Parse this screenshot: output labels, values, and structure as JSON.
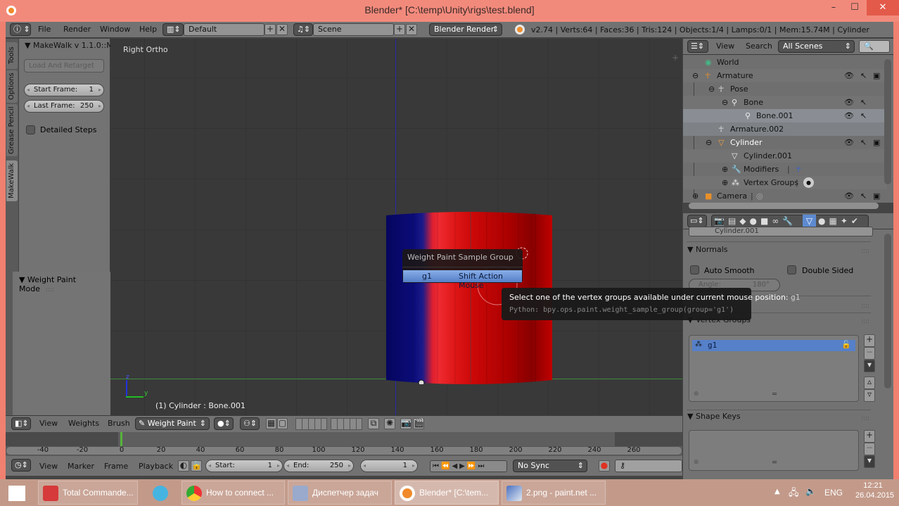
{
  "window": {
    "title": "Blender* [C:\\temp\\Unity\\rigs\\test.blend]",
    "minimize": "–",
    "maximize": "☐",
    "close": "✕"
  },
  "topbar": {
    "menus": [
      "File",
      "Render",
      "Window",
      "Help"
    ],
    "layout": "Default",
    "scene": "Scene",
    "engine": "Blender Render",
    "stats": "v2.74 | Verts:64 | Faces:36 | Tris:124 | Objects:1/4 | Lamps:0/1 | Mem:15.74M | Cylinder"
  },
  "left_tabs": [
    "Tools",
    "Options",
    "Grease Pencil",
    "MakeWalk"
  ],
  "toolshelf": {
    "panel_title": "MakeWalk v 1.1.0::M",
    "load_button": "Load And Retarget",
    "start_frame_label": "Start Frame:",
    "start_frame_value": "1",
    "last_frame_label": "Last Frame:",
    "last_frame_value": "250",
    "detailed_steps": "Detailed Steps",
    "mode_panel": "Weight Paint Mode"
  },
  "viewport": {
    "view_label": "Right Ortho",
    "object_label": "(1) Cylinder : Bone.001",
    "axis_z": "z",
    "axis_y": "y"
  },
  "popup": {
    "title": "Weight Paint Sample Group",
    "item_label": "g1",
    "item_shortcut": "Shift Action Mouse"
  },
  "tooltip": {
    "text": "Select one of the vertex groups available under current mouse position: ",
    "value": "g1",
    "python": "Python: bpy.ops.paint.weight_sample_group(group='g1')"
  },
  "outliner": {
    "view": "View",
    "search": "Search",
    "filter": "All Scenes",
    "items": [
      {
        "label": "World",
        "icon": "world-icon"
      },
      {
        "label": "Armature",
        "icon": "armature-icon"
      },
      {
        "label": "Pose",
        "icon": "pose-icon"
      },
      {
        "label": "Bone",
        "icon": "bone-icon"
      },
      {
        "label": "Bone.001",
        "icon": "bone-icon"
      },
      {
        "label": "Armature.002",
        "icon": "armature-data-icon"
      },
      {
        "label": "Cylinder",
        "icon": "mesh-object-icon"
      },
      {
        "label": "Cylinder.001",
        "icon": "mesh-data-icon"
      },
      {
        "label": "Modifiers",
        "icon": "wrench-icon"
      },
      {
        "label": "Vertex Groups",
        "icon": "vertex-groups-icon"
      },
      {
        "label": "Camera",
        "icon": "camera-icon"
      }
    ]
  },
  "properties": {
    "mesh_name": "Cylinder.001",
    "normals_title": "Normals",
    "auto_smooth": "Auto Smooth",
    "double_sided": "Double Sided",
    "angle_label": "Angle:",
    "angle_value": "180°",
    "vertex_groups_title": "Vertex Groups",
    "vertex_groups": [
      "g1"
    ],
    "shape_keys_title": "Shape Keys"
  },
  "viewport_header": {
    "menus": [
      "View",
      "Weights",
      "Brush"
    ],
    "mode": "Weight Paint"
  },
  "timeline": {
    "ticks": [
      "-40",
      "-20",
      "0",
      "20",
      "40",
      "60",
      "80",
      "100",
      "120",
      "140",
      "160",
      "180",
      "200",
      "220",
      "240",
      "260"
    ],
    "current_frame_marker": 0
  },
  "timeline_header": {
    "menus": [
      "View",
      "Marker",
      "Frame",
      "Playback"
    ],
    "start_label": "Start:",
    "start_value": "1",
    "end_label": "End:",
    "end_value": "250",
    "current_frame": "1",
    "sync": "No Sync"
  },
  "taskbar": {
    "tasks": [
      {
        "label": "Total Commande...",
        "active": false
      },
      {
        "label": "",
        "active": false
      },
      {
        "label": "How to connect ...",
        "active": false
      },
      {
        "label": "Диспетчер задач",
        "active": false
      },
      {
        "label": "Blender* [C:\\tem...",
        "active": true
      },
      {
        "label": "2.png - paint.net ...",
        "active": false
      }
    ],
    "lang": "ENG",
    "time": "12:21",
    "date": "26.04.2015"
  }
}
